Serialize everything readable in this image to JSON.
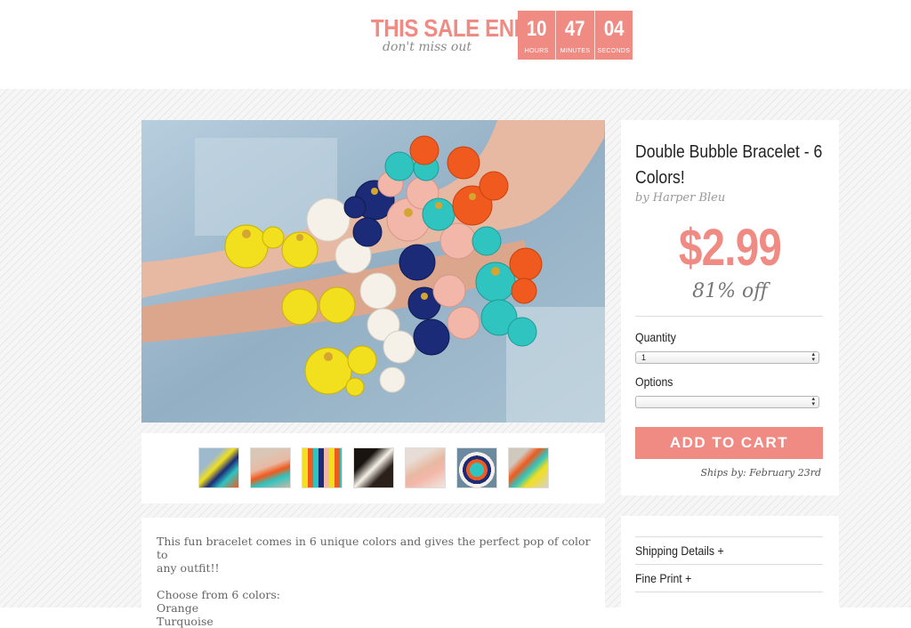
{
  "sale": {
    "title": "THIS SALE ENDS",
    "subtitle": "don't miss out",
    "timer": [
      {
        "value": "10",
        "label": "HOURS"
      },
      {
        "value": "47",
        "label": "MINUTES"
      },
      {
        "value": "04",
        "label": "SECONDS"
      }
    ]
  },
  "product": {
    "title": "Double Bubble Bracelet - 6 Colors!",
    "brand": "by Harper Bleu",
    "price": "$2.99",
    "discount": "81% off",
    "quantity_label": "Quantity",
    "quantity_value": "1",
    "options_label": "Options",
    "options_value": "",
    "add_to_cart": "ADD TO CART",
    "ships_by": "Ships by: February 23rd"
  },
  "description": {
    "line1": "This fun bracelet comes in 6 unique colors and gives the perfect pop of color to",
    "line2": "any outfit!!",
    "line3": "Choose from 6 colors:",
    "line4": "Orange",
    "line5": "Turquoise"
  },
  "info": {
    "shipping": "Shipping Details +",
    "fine_print": "Fine Print +"
  },
  "colors": {
    "accent": "#f08b84",
    "text_dark": "#222222",
    "text_muted": "#999999"
  }
}
